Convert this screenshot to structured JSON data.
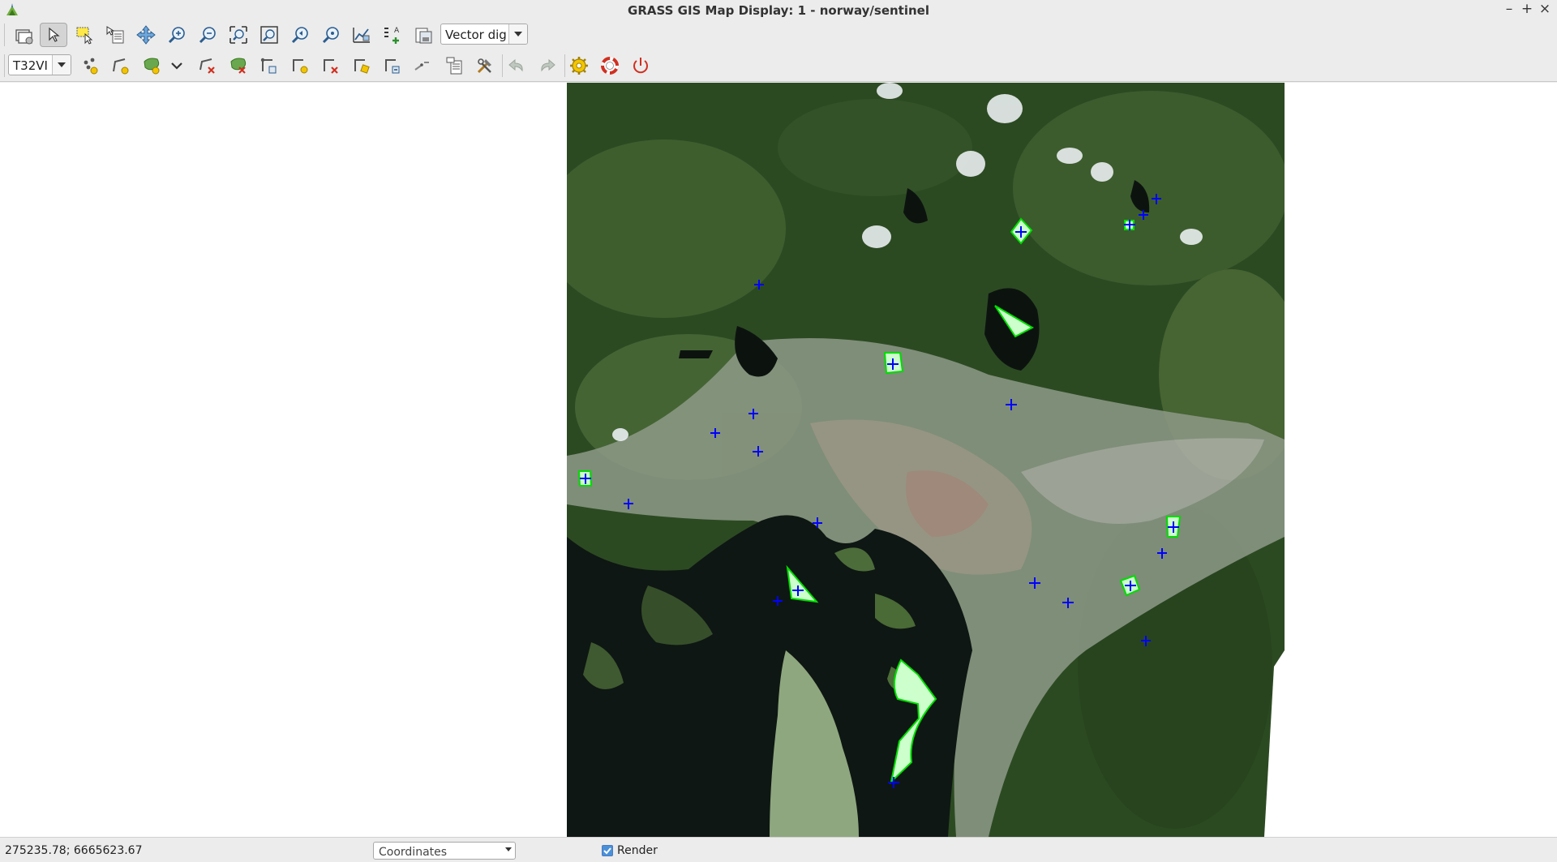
{
  "window": {
    "title": "GRASS GIS Map Display: 1 - norway/sentinel",
    "controls": [
      "–",
      "+",
      "×"
    ]
  },
  "toolbar_map": {
    "tools": [
      "add-map-icon",
      "pointer-icon",
      "select-icon",
      "query-icon",
      "pan-icon",
      "zoom-in-icon",
      "zoom-out-icon",
      "zoom-extent-icon",
      "zoom-region-icon",
      "zoom-back-icon",
      "zoom-menu-icon",
      "analyze-icon",
      "overlay-icon",
      "save-icon"
    ],
    "mode_select": "Vector dig"
  },
  "toolbar_digitizer": {
    "layer_select": "T32VI",
    "tools": [
      "add-point-icon",
      "add-line-icon",
      "add-area-icon",
      "more-icon",
      "delete-line-icon",
      "delete-area-icon",
      "move-vertex-icon",
      "add-vertex-icon",
      "remove-vertex-icon",
      "edit-line-icon",
      "move-line-icon",
      "display-cats-icon",
      "display-attr-icon",
      "additional-tools-icon",
      "undo-icon",
      "redo-icon",
      "settings-icon",
      "help-icon",
      "quit-icon"
    ]
  },
  "statusbar": {
    "coordinates": "275235.78; 6665623.67",
    "display_mode": "Coordinates",
    "render_label": "Render",
    "render_checked": true
  },
  "colors": {
    "vector_fill": "#ccffcc",
    "vector_outline": "#00dd00",
    "centroid": "#0000ff",
    "quit": "#d03020",
    "settings": "#e8c000"
  }
}
